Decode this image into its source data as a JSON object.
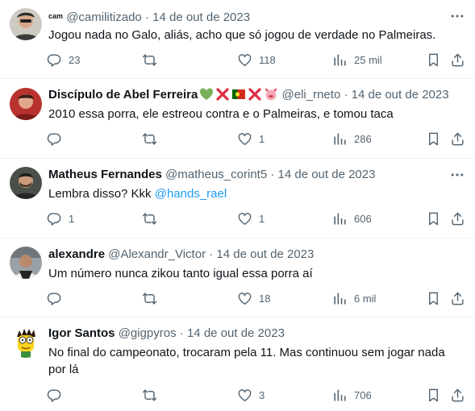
{
  "tweets": [
    {
      "name": "",
      "handle": "@camilitizado",
      "name_small": "cam",
      "date": "14 de out de 2023",
      "text": "Jogou nada no Galo, aliás, acho que só jogou de verdade no Palmeiras.",
      "replies": "23",
      "retweets": "",
      "likes": "118",
      "views": "25 mil"
    },
    {
      "name": "Discípulo de Abel Ferreira",
      "handle": "@eli_rneto",
      "date": "14 de out de 2023",
      "text": "2010 essa porra, ele estreou contra e o Palmeiras, e tomou taca",
      "replies": "",
      "retweets": "",
      "likes": "1",
      "views": "286"
    },
    {
      "name": "Matheus Fernandes",
      "handle": "@matheus_corint5",
      "date": "14 de out de 2023",
      "text": "Lembra disso? Kkk",
      "mention": "@hands_rael",
      "replies": "1",
      "retweets": "",
      "likes": "1",
      "views": "606"
    },
    {
      "name": "alexandre",
      "handle": "@Alexandr_Victor",
      "date": "14 de out de 2023",
      "text": "Um número nunca zikou tanto igual essa porra aí",
      "replies": "",
      "retweets": "",
      "likes": "18",
      "views": "6 mil"
    },
    {
      "name": "Igor Santos",
      "handle": "@gigpyros",
      "date": "14 de out de 2023",
      "text_line1": "No final do campeonato, trocaram pela 11. Mas continuou sem jogar nada",
      "text_line2": "por lá",
      "replies": "",
      "retweets": "",
      "likes": "3",
      "views": "706"
    }
  ],
  "separator": "·",
  "icons": [
    "reply-icon",
    "retweet-icon",
    "like-icon",
    "views-icon",
    "bookmark-icon",
    "share-icon",
    "more-icon"
  ],
  "colors": {
    "text": "#0f1419",
    "secondary": "#536471",
    "link": "#1d9bf0",
    "divider": "#eff3f4"
  }
}
